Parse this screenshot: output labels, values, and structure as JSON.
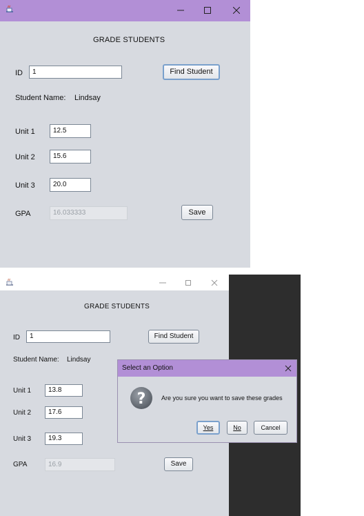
{
  "screen1": {
    "heading": "GRADE STUDENTS",
    "id_label": "ID",
    "id_value": "1",
    "find_button": "Find Student",
    "student_name_label": "Student Name:",
    "student_name_value": "Lindsay",
    "unit1_label": "Unit 1",
    "unit1_value": "12.5",
    "unit2_label": "Unit 2",
    "unit2_value": "15.6",
    "unit3_label": "Unit 3",
    "unit3_value": "20.0",
    "gpa_label": "GPA",
    "gpa_value": "16.033333",
    "save_button": "Save"
  },
  "screen2": {
    "heading": "GRADE STUDENTS",
    "id_label": "ID",
    "id_value": "1",
    "find_button": "Find Student",
    "student_name_label": "Student Name:",
    "student_name_value": "Lindsay",
    "unit1_label": "Unit 1",
    "unit1_value": "13.8",
    "unit2_label": "Unit 2",
    "unit2_value": "17.6",
    "unit3_label": "Unit 3",
    "unit3_value": "19.3",
    "gpa_label": "GPA",
    "gpa_value": "16.9",
    "save_button": "Save"
  },
  "dialog": {
    "title": "Select an Option",
    "message": "Are you sure you want to save these grades",
    "yes_button": "Yes",
    "no_button": "No",
    "cancel_button": "Cancel"
  },
  "icons": {
    "app": "java-coffee-cup-icon",
    "question": "question-icon"
  },
  "colors": {
    "active_titlebar": "#b28fd6",
    "window_bg": "#d7dae0"
  }
}
